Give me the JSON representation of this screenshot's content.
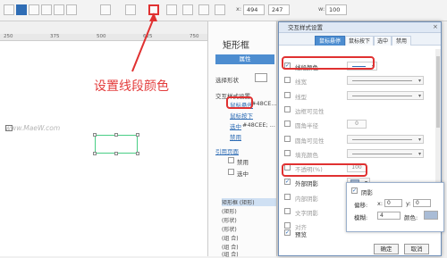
{
  "toolbar": {
    "x_label": "x:",
    "x_value": "494",
    "y_value": "247",
    "w_label": "w:",
    "w_value": "100"
  },
  "ruler": {
    "ticks": [
      "250",
      "375",
      "500",
      "625",
      "750"
    ]
  },
  "canvas": {
    "watermark": "www.MaeW.com",
    "annotation": "设置线段颜色"
  },
  "panel": {
    "title": "矩形框",
    "bar_label": "属性",
    "select_shape_label": "选择形状",
    "interaction_title": "交互样式设置",
    "mouse_hover": "鼠标悬停",
    "hover_color": "#48CE...",
    "mouse_down": "鼠标按下",
    "selected": "选中",
    "selected_color": "#48CEE; ...",
    "disabled_link": "禁用",
    "ref_page": "引用页面",
    "cb_disabled": "禁用",
    "cb_selected": "选中",
    "outline": [
      "矩形框 (矩形)",
      "(矩形)",
      "(形状)",
      "(形状)",
      "(组 合)",
      "(组 合)",
      "(组 合)"
    ]
  },
  "dialog": {
    "title": "交互样式设置",
    "tabs": [
      "鼠标悬停",
      "鼠标按下",
      "选中",
      "禁用"
    ],
    "rows": [
      {
        "label": "线段颜色",
        "checked": true
      },
      {
        "label": "线宽",
        "checked": false
      },
      {
        "label": "线型",
        "checked": false
      },
      {
        "label": "边框可见性",
        "checked": false
      },
      {
        "label": "圆角半径",
        "checked": false,
        "value": "0"
      },
      {
        "label": "圆角可见性",
        "checked": false
      },
      {
        "label": "填充颜色",
        "checked": false
      },
      {
        "label": "不透明(%)",
        "checked": false,
        "value": "100"
      },
      {
        "label": "外部阴影",
        "checked": true
      },
      {
        "label": "内部阴影",
        "checked": false
      },
      {
        "label": "文字阴影",
        "checked": false
      },
      {
        "label": "对齐",
        "checked": false
      }
    ],
    "preview_label": "预览",
    "ok": "确定",
    "cancel": "取消"
  },
  "shadow_popup": {
    "title": "阴影",
    "offset_label": "偏移:",
    "x_label": "x:",
    "x_value": "0",
    "y_label": "y:",
    "y_value": "0",
    "blur_label": "模糊:",
    "blur_value": "4",
    "color_label": "颜色:"
  },
  "colors": {
    "accent": "#4d8dd0",
    "highlight": "#e03131",
    "shape_border": "#48ce85"
  }
}
